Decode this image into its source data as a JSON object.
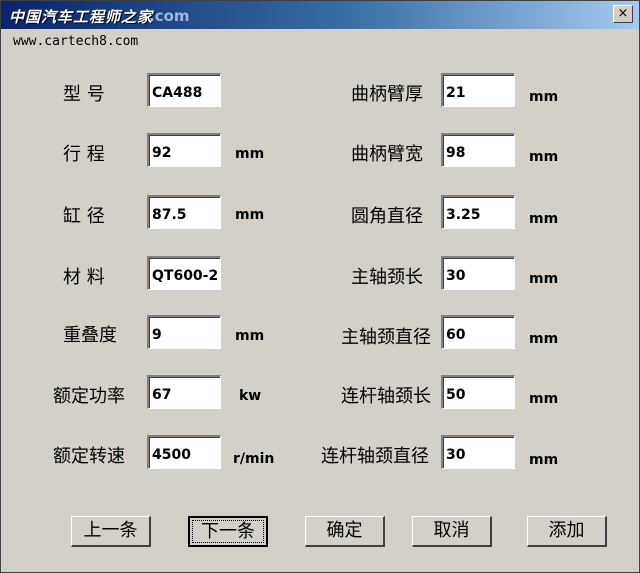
{
  "window": {
    "title": "中国汽车工程师之家",
    "watermark": ".com",
    "close_glyph": "×"
  },
  "url": "www.cartech8.com",
  "left": [
    {
      "label": "型  号",
      "value": "CA488",
      "unit": ""
    },
    {
      "label": "行  程",
      "value": "92",
      "unit": "mm"
    },
    {
      "label": "缸  径",
      "value": "87.5",
      "unit": "mm"
    },
    {
      "label": "材  料",
      "value": "QT600-2",
      "unit": ""
    },
    {
      "label": "重叠度",
      "value": "9",
      "unit": "mm"
    },
    {
      "label": "额定功率",
      "value": "67",
      "unit": "kw"
    },
    {
      "label": "额定转速",
      "value": "4500",
      "unit": "r/min"
    }
  ],
  "right": [
    {
      "label": "曲柄臂厚",
      "value": "21",
      "unit": "mm"
    },
    {
      "label": "曲柄臂宽",
      "value": "98",
      "unit": "mm"
    },
    {
      "label": "圆角直径",
      "value": "3.25",
      "unit": "mm"
    },
    {
      "label": "主轴颈长",
      "value": "30",
      "unit": "mm"
    },
    {
      "label": "主轴颈直径",
      "value": "60",
      "unit": "mm"
    },
    {
      "label": "连杆轴颈长",
      "value": "50",
      "unit": "mm"
    },
    {
      "label": "连杆轴颈直径",
      "value": "30",
      "unit": "mm"
    }
  ],
  "buttons": {
    "prev": "上一条",
    "next": "下一条",
    "ok": "确定",
    "cancel": "取消",
    "add": "添加"
  }
}
